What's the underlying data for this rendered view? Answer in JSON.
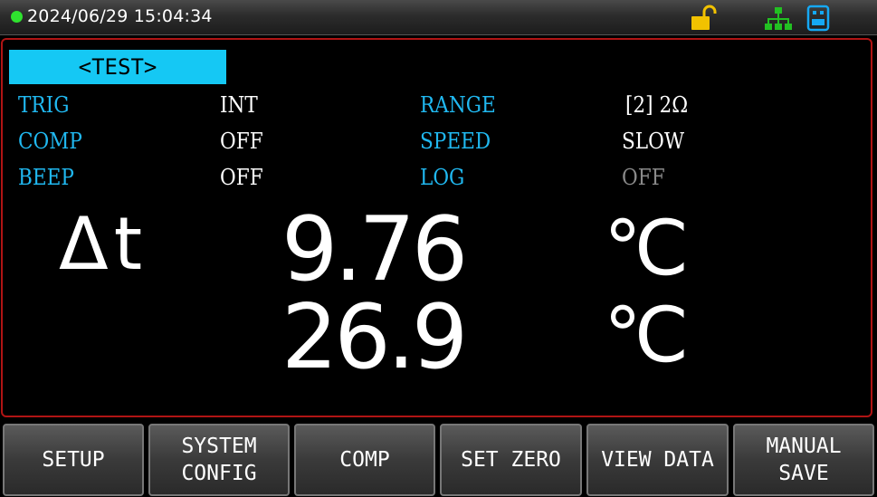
{
  "status_bar": {
    "datetime": "2024/06/29  15:04:34",
    "icons": [
      "status-dot",
      "unlock-icon",
      "network-icon",
      "usb-icon"
    ]
  },
  "page": {
    "tab_label": "<TEST>"
  },
  "params": {
    "trig": {
      "label": "TRIG",
      "value": "INT"
    },
    "comp": {
      "label": "COMP",
      "value": "OFF"
    },
    "beep": {
      "label": "BEEP",
      "value": "OFF"
    },
    "range": {
      "label": "RANGE",
      "value": "[2] 2Ω"
    },
    "speed": {
      "label": "SPEED",
      "value": "SLOW"
    },
    "log": {
      "label": "LOG",
      "value": "OFF"
    }
  },
  "measurement": {
    "symbol": "Δt",
    "primary_value": "9.76",
    "primary_unit": "℃",
    "secondary_value": "26.9",
    "secondary_unit": "℃"
  },
  "softkeys": {
    "setup": "SETUP",
    "system_config": "SYSTEM\nCONFIG",
    "comp": "COMP",
    "set_zero": "SET ZERO",
    "view_data": "VIEW DATA",
    "manual_save": "MANUAL\nSAVE"
  },
  "colors": {
    "accent": "#15c8f4",
    "label": "#20b8f0",
    "panel_border": "#b01414",
    "status_ok": "#2fe22f",
    "lock": "#f2c200",
    "network": "#22c022"
  }
}
